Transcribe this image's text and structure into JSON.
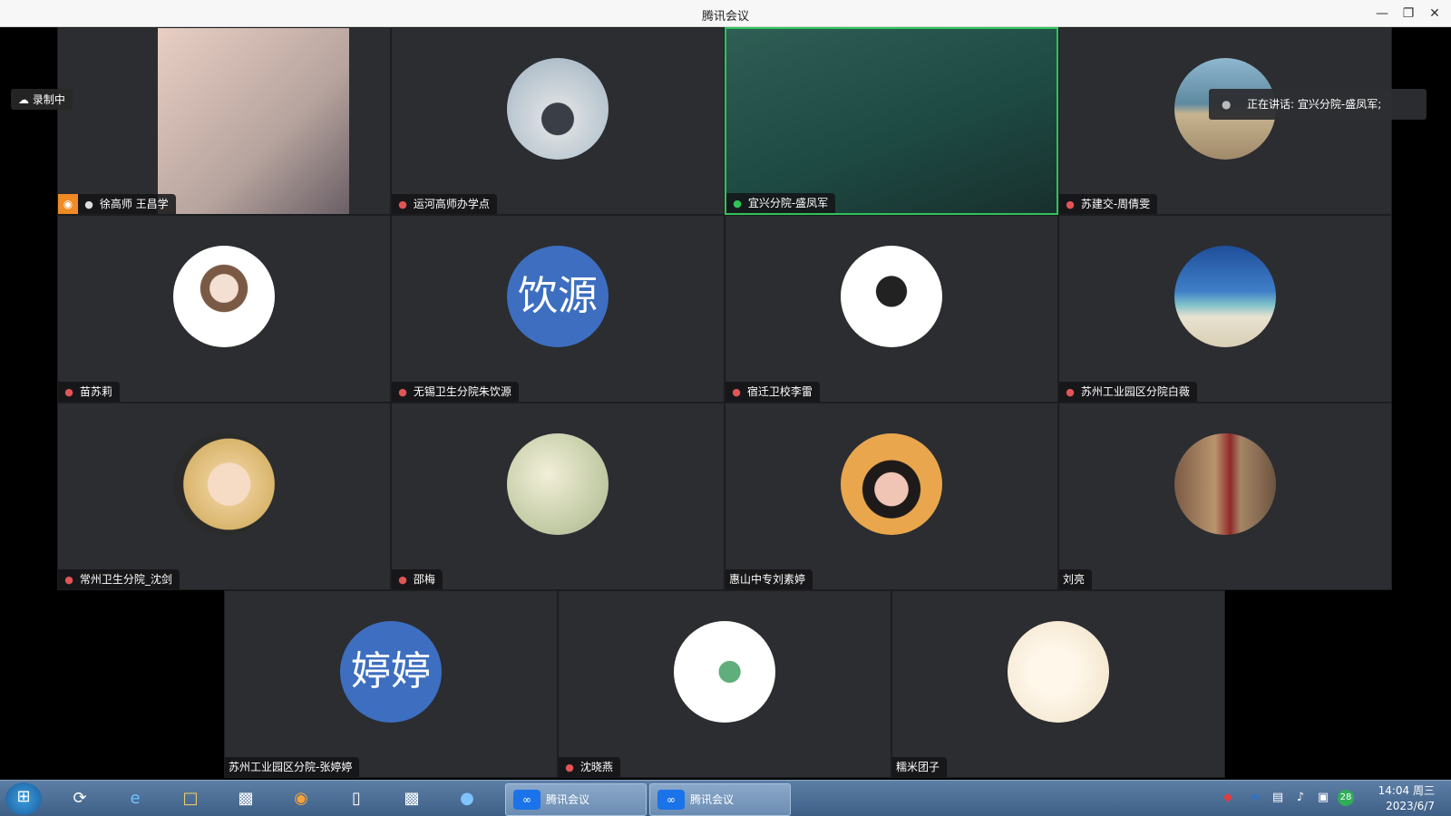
{
  "window": {
    "title": "腾讯会议"
  },
  "recording": {
    "label": "录制中"
  },
  "speaking": {
    "label": "正在讲话:",
    "name": "宜兴分院-盛凤军;"
  },
  "participants": [
    {
      "name": "徐高师 王昌学",
      "mic": "on",
      "host": true,
      "video": "photo"
    },
    {
      "name": "运河高师办学点",
      "mic": "muted",
      "avatar": "photo"
    },
    {
      "name": "宜兴分院-盛凤军",
      "mic": "active",
      "video": "photo",
      "active": true
    },
    {
      "name": "苏建交-周倩雯",
      "mic": "muted",
      "avatar": "photo"
    },
    {
      "name": "苗苏莉",
      "mic": "muted",
      "avatar": "photo"
    },
    {
      "name": "无锡卫生分院朱饮源",
      "mic": "muted",
      "avatar_text": "饮源"
    },
    {
      "name": "宿迁卫校李雷",
      "mic": "muted",
      "avatar": "photo"
    },
    {
      "name": "苏州工业园区分院白薇",
      "mic": "muted",
      "avatar": "photo"
    },
    {
      "name": "常州卫生分院_沈剑",
      "mic": "muted",
      "avatar": "photo"
    },
    {
      "name": "邵梅",
      "mic": "muted",
      "avatar": "photo"
    },
    {
      "name": "惠山中专刘素婷",
      "mic": "none",
      "avatar": "photo"
    },
    {
      "name": "刘亮",
      "mic": "none",
      "avatar": "photo"
    },
    {
      "name": "苏州工业园区分院-张婷婷",
      "mic": "none",
      "avatar_text": "婷婷"
    },
    {
      "name": "沈晓燕",
      "mic": "muted",
      "avatar": "photo"
    },
    {
      "name": "糯米团子",
      "mic": "none",
      "avatar": "photo"
    }
  ],
  "taskbar": {
    "tasks": [
      {
        "label": "腾讯会议"
      },
      {
        "label": "腾讯会议"
      }
    ],
    "clock": {
      "time": "14:04 周三",
      "date": "2023/6/7"
    },
    "badge": "28"
  },
  "colors": {
    "accent": "#2fc35a",
    "tile_bg": "#2b2d31",
    "avatar_text_bg": "#3d6ec0",
    "host_badge": "#f08a24"
  }
}
